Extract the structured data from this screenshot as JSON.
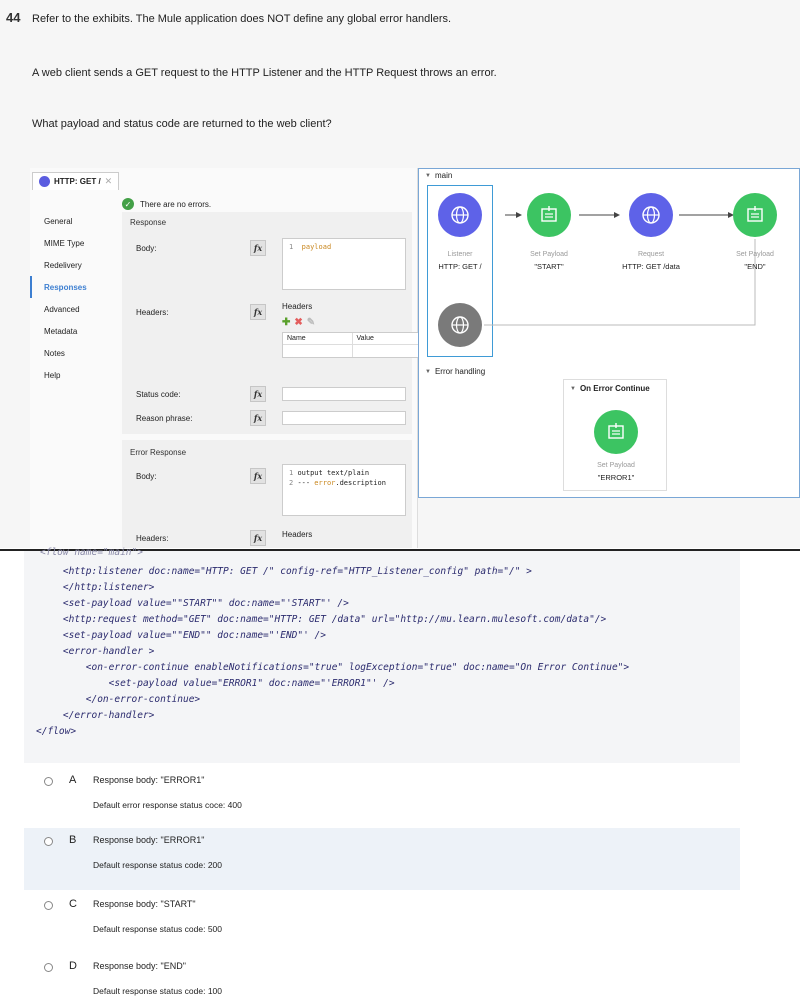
{
  "question": {
    "number": "44",
    "line1": "Refer to the exhibits.  The Mule application does NOT define any global error handlers.",
    "line2": "A web client sends a GET request to the HTTP Listener and the HTTP Request throws an error.",
    "line3": "What payload and status code are returned to the web client?"
  },
  "properties_panel": {
    "tab_title": "HTTP: GET /",
    "status_text": "There are no errors.",
    "nav": [
      "General",
      "MIME Type",
      "Redelivery",
      "Responses",
      "Advanced",
      "Metadata",
      "Notes",
      "Help"
    ],
    "active_nav": "Responses",
    "response": {
      "section_title": "Response",
      "body_label": "Body:",
      "body_line_no": "1",
      "body_code": "payload",
      "headers_label": "Headers:",
      "headers_title": "Headers",
      "col_name": "Name",
      "col_value": "Value",
      "status_code_label": "Status code:",
      "reason_phrase_label": "Reason phrase:"
    },
    "error_response": {
      "section_title": "Error Response",
      "body_label": "Body:",
      "line1_no": "1",
      "line1_code": "output text/plain",
      "line2_no": "2",
      "line2_code_prefix": "--- ",
      "line2_code_kw": "error",
      "line2_code_suffix": ".description",
      "headers_label": "Headers:",
      "headers_title": "Headers"
    },
    "fx_label": "fx"
  },
  "flow_canvas": {
    "main_label": "main",
    "nodes": [
      {
        "type": "Listener",
        "name": "HTTP: GET /",
        "color": "#5e62e8",
        "icon": "globe-icon"
      },
      {
        "type": "Set Payload",
        "name": "\"START\"",
        "color": "#3cc462",
        "icon": "set-payload-icon"
      },
      {
        "type": "Request",
        "name": "HTTP: GET /data",
        "color": "#5e62e8",
        "icon": "globe-icon"
      },
      {
        "type": "Set Payload",
        "name": "\"END\"",
        "color": "#3cc462",
        "icon": "set-payload-icon"
      }
    ],
    "error_handling_label": "Error handling",
    "on_error_label": "On Error Continue",
    "error_node": {
      "type": "Set Payload",
      "name": "\"ERROR1\""
    }
  },
  "xml_lines": [
    "<flow name=\"main\">",
    "    <http:listener doc:name=\"HTTP: GET /\" config-ref=\"HTTP_Listener_config\" path=\"/\" >",
    "    </http:listener>",
    "    <set-payload value=\"\"START\"\" doc:name=\"'START\"' />",
    "    <http:request method=\"GET\" doc:name=\"HTTP: GET /data\" url=\"http://mu.learn.mulesoft.com/data\"/>",
    "    <set-payload value=\"\"END\"\" doc:name=\"'END\"' />",
    "    <error-handler >",
    "        <on-error-continue enableNotifications=\"true\" logException=\"true\" doc:name=\"On Error Continue\">",
    "            <set-payload value=\"ERROR1\" doc:name=\"'ERROR1\"' />",
    "        </on-error-continue>",
    "    </error-handler>",
    "</flow>"
  ],
  "options": [
    {
      "letter": "A",
      "line1": "Response body: \"ERROR1\"",
      "line2": "Default error response status coce: 400"
    },
    {
      "letter": "B",
      "line1": "Response body: \"ERROR1\"",
      "line2": "Default response status code: 200"
    },
    {
      "letter": "C",
      "line1": "Response body: \"START\"",
      "line2": "Default response status code: 500"
    },
    {
      "letter": "D",
      "line1": "Response body: \"END\"",
      "line2": "Default response status code: 100"
    }
  ]
}
